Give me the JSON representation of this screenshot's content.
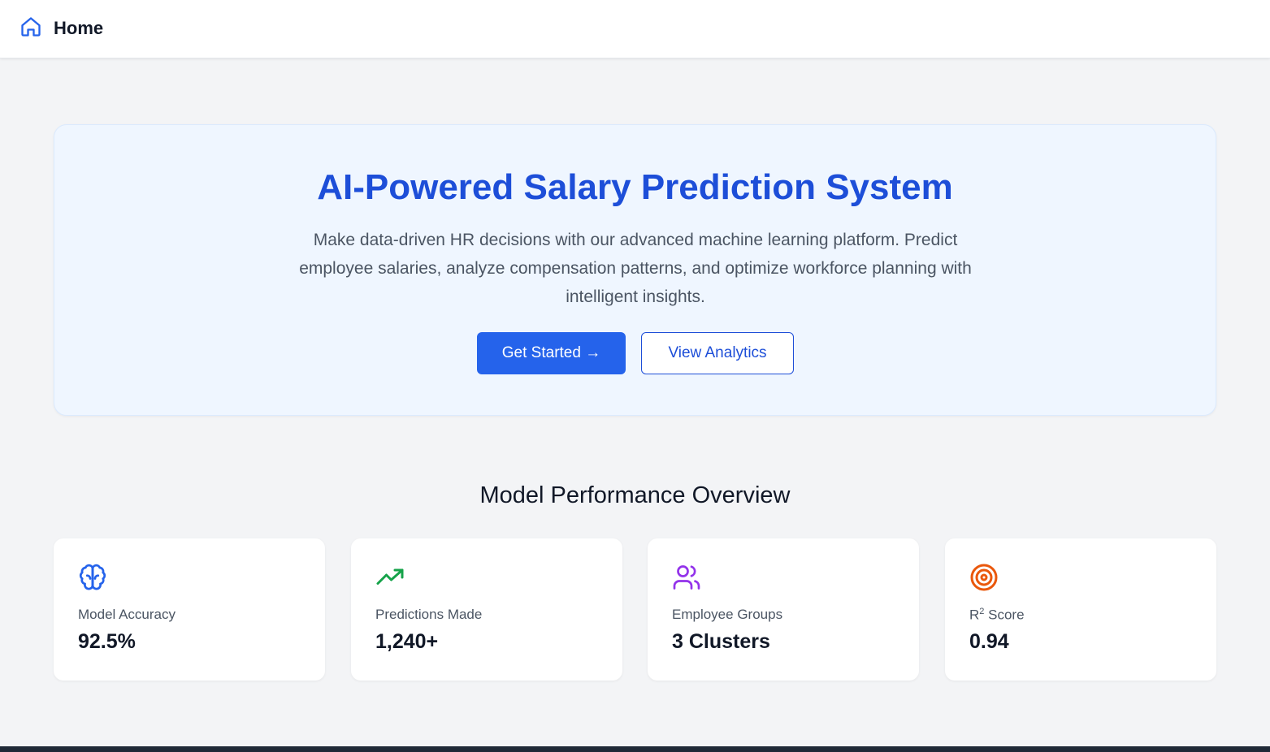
{
  "nav": {
    "home_label": "Home",
    "home_icon": "home-icon"
  },
  "hero": {
    "title": "AI-Powered Salary Prediction System",
    "description": "Make data-driven HR decisions with our advanced machine learning platform. Predict employee salaries, analyze compensation patterns, and optimize workforce planning with intelligent insights.",
    "primary_button": "Get Started →",
    "secondary_button": "View Analytics"
  },
  "overview": {
    "title": "Model Performance Overview",
    "cards": [
      {
        "icon": "brain-icon",
        "icon_color": "#2563eb",
        "label": "Model Accuracy",
        "value": "92.5%"
      },
      {
        "icon": "trending-up-icon",
        "icon_color": "#16a34a",
        "label": "Predictions Made",
        "value": "1,240+"
      },
      {
        "icon": "users-icon",
        "icon_color": "#9333ea",
        "label": "Employee Groups",
        "value": "3 Clusters"
      },
      {
        "icon": "target-icon",
        "icon_color": "#ea580c",
        "label_main": "R",
        "label_sup": "2",
        "label_rest": " Score",
        "value": "0.94"
      }
    ]
  },
  "colors": {
    "accent": "#2563eb",
    "hero_title": "#1d4ed8",
    "background": "#f3f4f6",
    "hero_background": "#eff6ff"
  }
}
